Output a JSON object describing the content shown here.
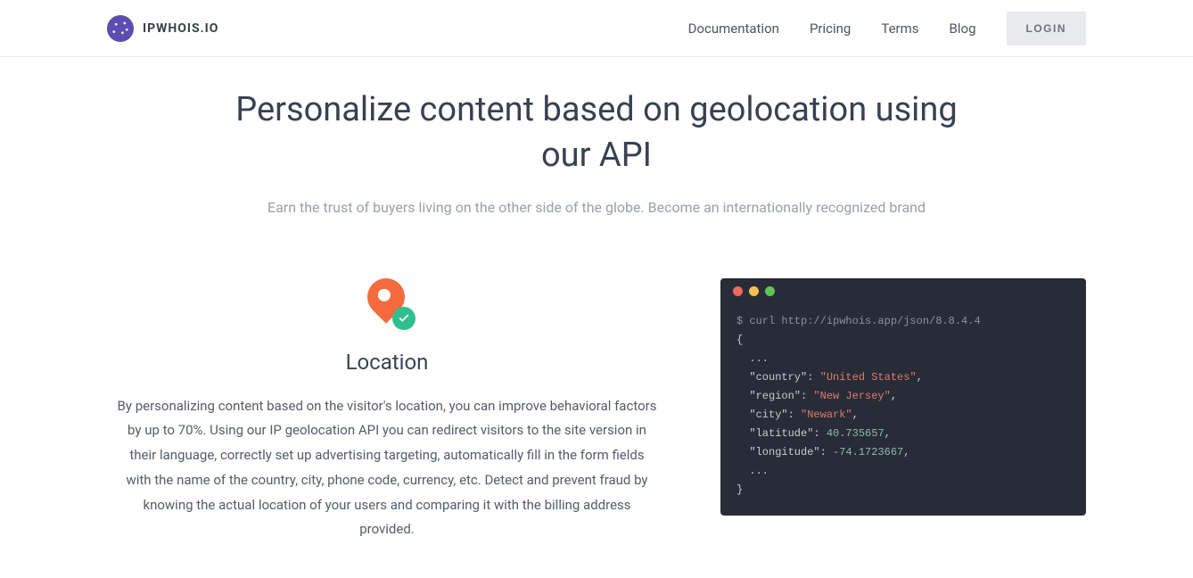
{
  "header": {
    "brand": "IPWHOIS.IO",
    "nav": {
      "documentation": "Documentation",
      "pricing": "Pricing",
      "terms": "Terms",
      "blog": "Blog"
    },
    "login": "LOGIN"
  },
  "hero": {
    "title": "Personalize content based on geolocation using our API",
    "subtitle": "Earn the trust of buyers living on the other side of the globe. Become an internationally recognized brand"
  },
  "feature": {
    "title": "Location",
    "desc": "By personalizing content based on the visitor's location, you can improve behavioral factors by up to 70%. Using our IP geolocation API you can redirect visitors to the site version in their language, correctly set up advertising targeting, automatically fill in the form fields with the name of the country, city, phone code, currency, etc. Detect and prevent fraud by knowing the actual location of your users and comparing it with the billing address provided."
  },
  "terminal": {
    "cmd": "$ curl http://ipwhois.app/json/8.8.4.4",
    "open": "{",
    "ell1": "  ...",
    "country_k": "  \"country\": ",
    "country_v": "\"United States\"",
    "region_k": "  \"region\": ",
    "region_v": "\"New Jersey\"",
    "city_k": "  \"city\": ",
    "city_v": "\"Newark\"",
    "lat_k": "  \"latitude\": ",
    "lat_v": "40.735657",
    "lon_k": "  \"longitude\": ",
    "lon_v": "-74.1723667",
    "ell2": "  ...",
    "close": "}",
    "comma": ","
  }
}
